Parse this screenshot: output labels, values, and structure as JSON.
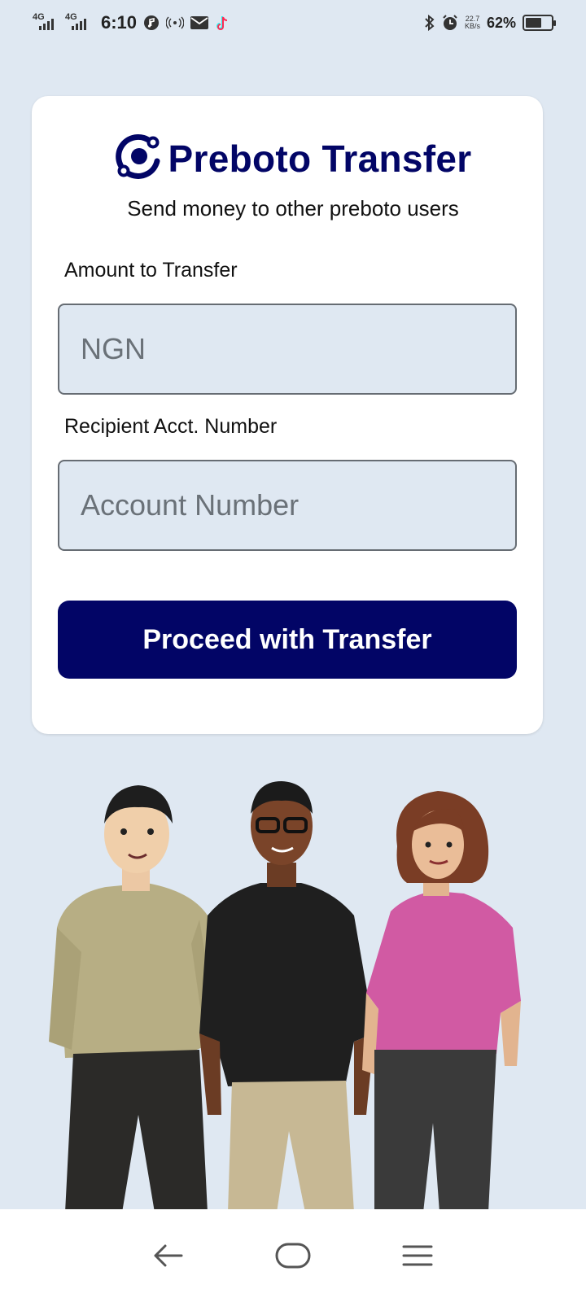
{
  "status_bar": {
    "network_1": "4G",
    "network_2": "4G",
    "time": "6:10",
    "speed_value": "22.7",
    "speed_unit": "KB/s",
    "battery_percent": "62%",
    "battery_level": 0.62,
    "icons": [
      "signal-icon",
      "signal-icon",
      "music-icon",
      "hotspot-icon",
      "mail-icon",
      "tiktok-icon",
      "bluetooth-icon",
      "alarm-icon",
      "battery-icon"
    ]
  },
  "brand": {
    "title": "Preboto Transfer",
    "logo_icon": "preboto-logo-icon",
    "color": "#020566"
  },
  "subtitle": "Send money to other preboto users",
  "form": {
    "amount_label": "Amount to Transfer",
    "amount_value": "",
    "amount_placeholder": "NGN",
    "account_label": "Recipient Acct. Number",
    "account_value": "",
    "account_placeholder": "Account Number",
    "submit_label": "Proceed with Transfer"
  },
  "colors": {
    "background": "#dfe8f2",
    "card": "#ffffff",
    "accent": "#020566"
  },
  "illustration": {
    "name": "three-people-illustration"
  },
  "nav_bar": {
    "icons": [
      "back-icon",
      "home-icon",
      "menu-icon"
    ]
  }
}
